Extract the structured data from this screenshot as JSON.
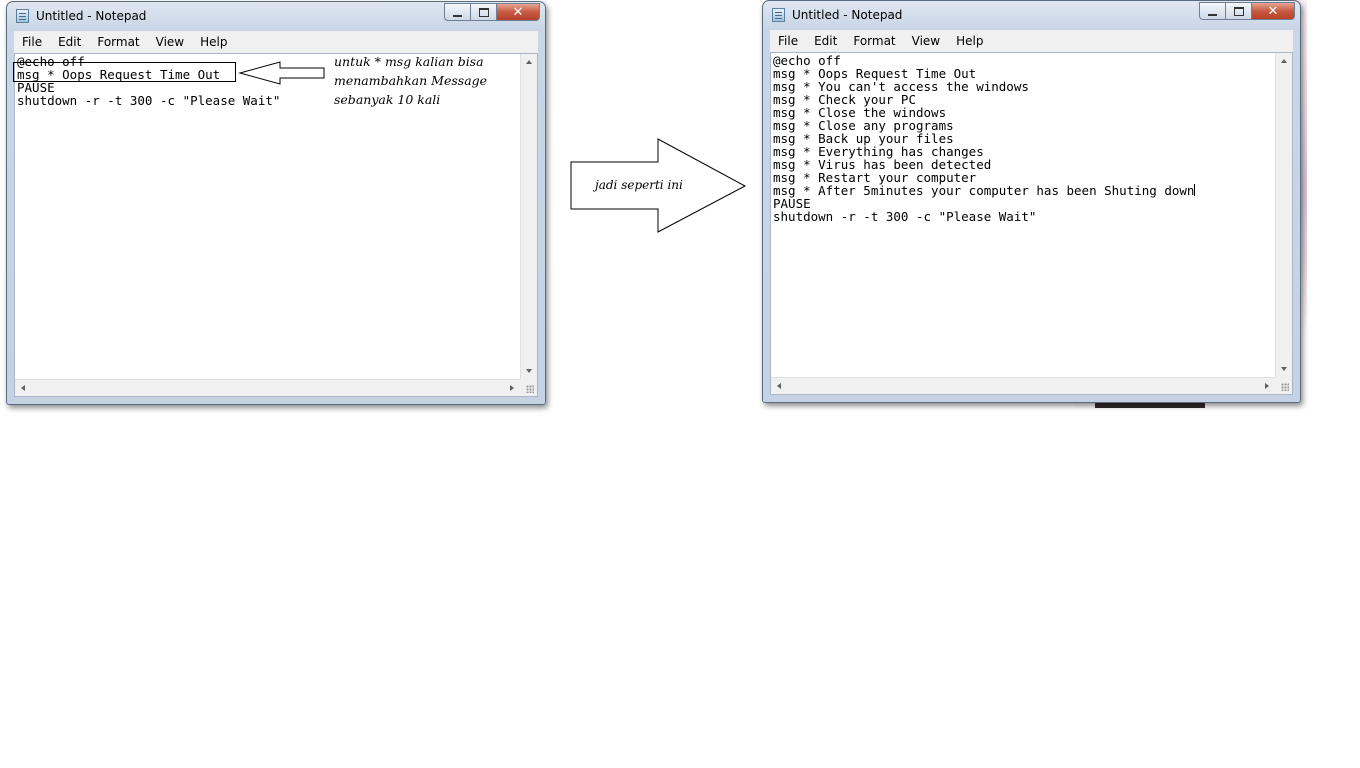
{
  "left_window": {
    "title": "Untitled - Notepad",
    "menu": [
      "File",
      "Edit",
      "Format",
      "View",
      "Help"
    ],
    "close_symbol": "✕",
    "content": "@echo off\nmsg * Oops Request Time Out\nPAUSE\nshutdown -r -t 300 -c \"Please Wait\""
  },
  "annotation": {
    "lines": [
      "untuk * msg kalian bisa",
      "menambahkan Message",
      "sebanyak 10 kali"
    ]
  },
  "transition_label": "jadi seperti ini",
  "right_window": {
    "title": "Untitled - Notepad",
    "menu": [
      "File",
      "Edit",
      "Format",
      "View",
      "Help"
    ],
    "close_symbol": "✕",
    "content_before_caret": "@echo off\nmsg * Oops Request Time Out\nmsg * You can't access the windows\nmsg * Check your PC\nmsg * Close the windows\nmsg * Close any programs\nmsg * Back up your files\nmsg * Everything has changes\nmsg * Virus has been detected\nmsg * Restart your computer\nmsg * After 5minutes your computer has been Shuting down",
    "content_after_caret": "\nPAUSE\nshutdown -r -t 300 -c \"Please Wait\""
  },
  "icons": {
    "app_icon": "notepad-icon",
    "minimize": "minimize-icon",
    "maximize": "maximize-icon",
    "close": "close-icon"
  }
}
